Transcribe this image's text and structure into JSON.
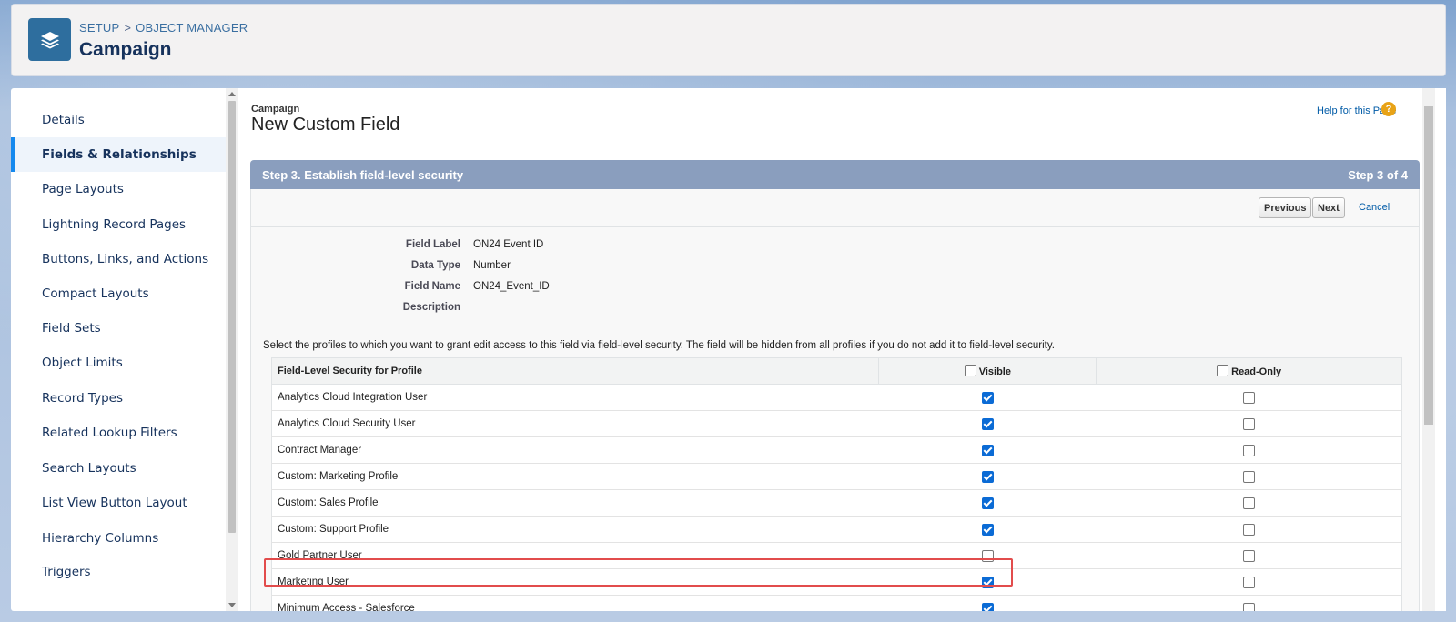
{
  "header": {
    "breadcrumb": [
      "SETUP",
      "OBJECT MANAGER"
    ],
    "breadcrumb_sep": ">",
    "title": "Campaign",
    "icon": "layers-icon"
  },
  "sidebar": {
    "items": [
      {
        "label": "Details",
        "active": false
      },
      {
        "label": "Fields & Relationships",
        "active": true
      },
      {
        "label": "Page Layouts",
        "active": false
      },
      {
        "label": "Lightning Record Pages",
        "active": false
      },
      {
        "label": "Buttons, Links, and Actions",
        "active": false
      },
      {
        "label": "Compact Layouts",
        "active": false
      },
      {
        "label": "Field Sets",
        "active": false
      },
      {
        "label": "Object Limits",
        "active": false
      },
      {
        "label": "Record Types",
        "active": false
      },
      {
        "label": "Related Lookup Filters",
        "active": false
      },
      {
        "label": "Search Layouts",
        "active": false
      },
      {
        "label": "List View Button Layout",
        "active": false
      },
      {
        "label": "Hierarchy Columns",
        "active": false
      },
      {
        "label": "Triggers",
        "active": false
      }
    ]
  },
  "main": {
    "object_label": "Campaign",
    "page_title": "New Custom Field",
    "help_link": "Help for this Page",
    "help_icon_glyph": "?",
    "step_title": "Step 3. Establish field-level security",
    "step_count": "Step 3 of 4",
    "buttons": {
      "previous": "Previous",
      "next": "Next",
      "cancel": "Cancel"
    },
    "details": [
      {
        "label": "Field Label",
        "value": "ON24 Event ID"
      },
      {
        "label": "Data Type",
        "value": "Number"
      },
      {
        "label": "Field Name",
        "value": "ON24_Event_ID"
      },
      {
        "label": "Description",
        "value": ""
      }
    ],
    "instructions": "Select the profiles to which you want to grant edit access to this field via field-level security. The field will be hidden from all profiles if you do not add it to field-level security.",
    "table": {
      "headers": {
        "profile": "Field-Level Security for Profile",
        "visible": "Visible",
        "read_only": "Read-Only"
      },
      "rows": [
        {
          "profile": "Analytics Cloud Integration User",
          "visible": true,
          "read_only": false
        },
        {
          "profile": "Analytics Cloud Security User",
          "visible": true,
          "read_only": false
        },
        {
          "profile": "Contract Manager",
          "visible": true,
          "read_only": false
        },
        {
          "profile": "Custom: Marketing Profile",
          "visible": true,
          "read_only": false
        },
        {
          "profile": "Custom: Sales Profile",
          "visible": true,
          "read_only": false
        },
        {
          "profile": "Custom: Support Profile",
          "visible": true,
          "read_only": false
        },
        {
          "profile": "Gold Partner User",
          "visible": false,
          "read_only": false
        },
        {
          "profile": "Marketing User",
          "visible": true,
          "read_only": false,
          "highlighted": true
        },
        {
          "profile": "Minimum Access - Salesforce",
          "visible": true,
          "read_only": false
        }
      ]
    }
  },
  "colors": {
    "accent": "#1589ee",
    "step_bar": "#8a9ebe",
    "checkbox_checked": "#0b6bd5",
    "highlight": "#e24c4c"
  }
}
